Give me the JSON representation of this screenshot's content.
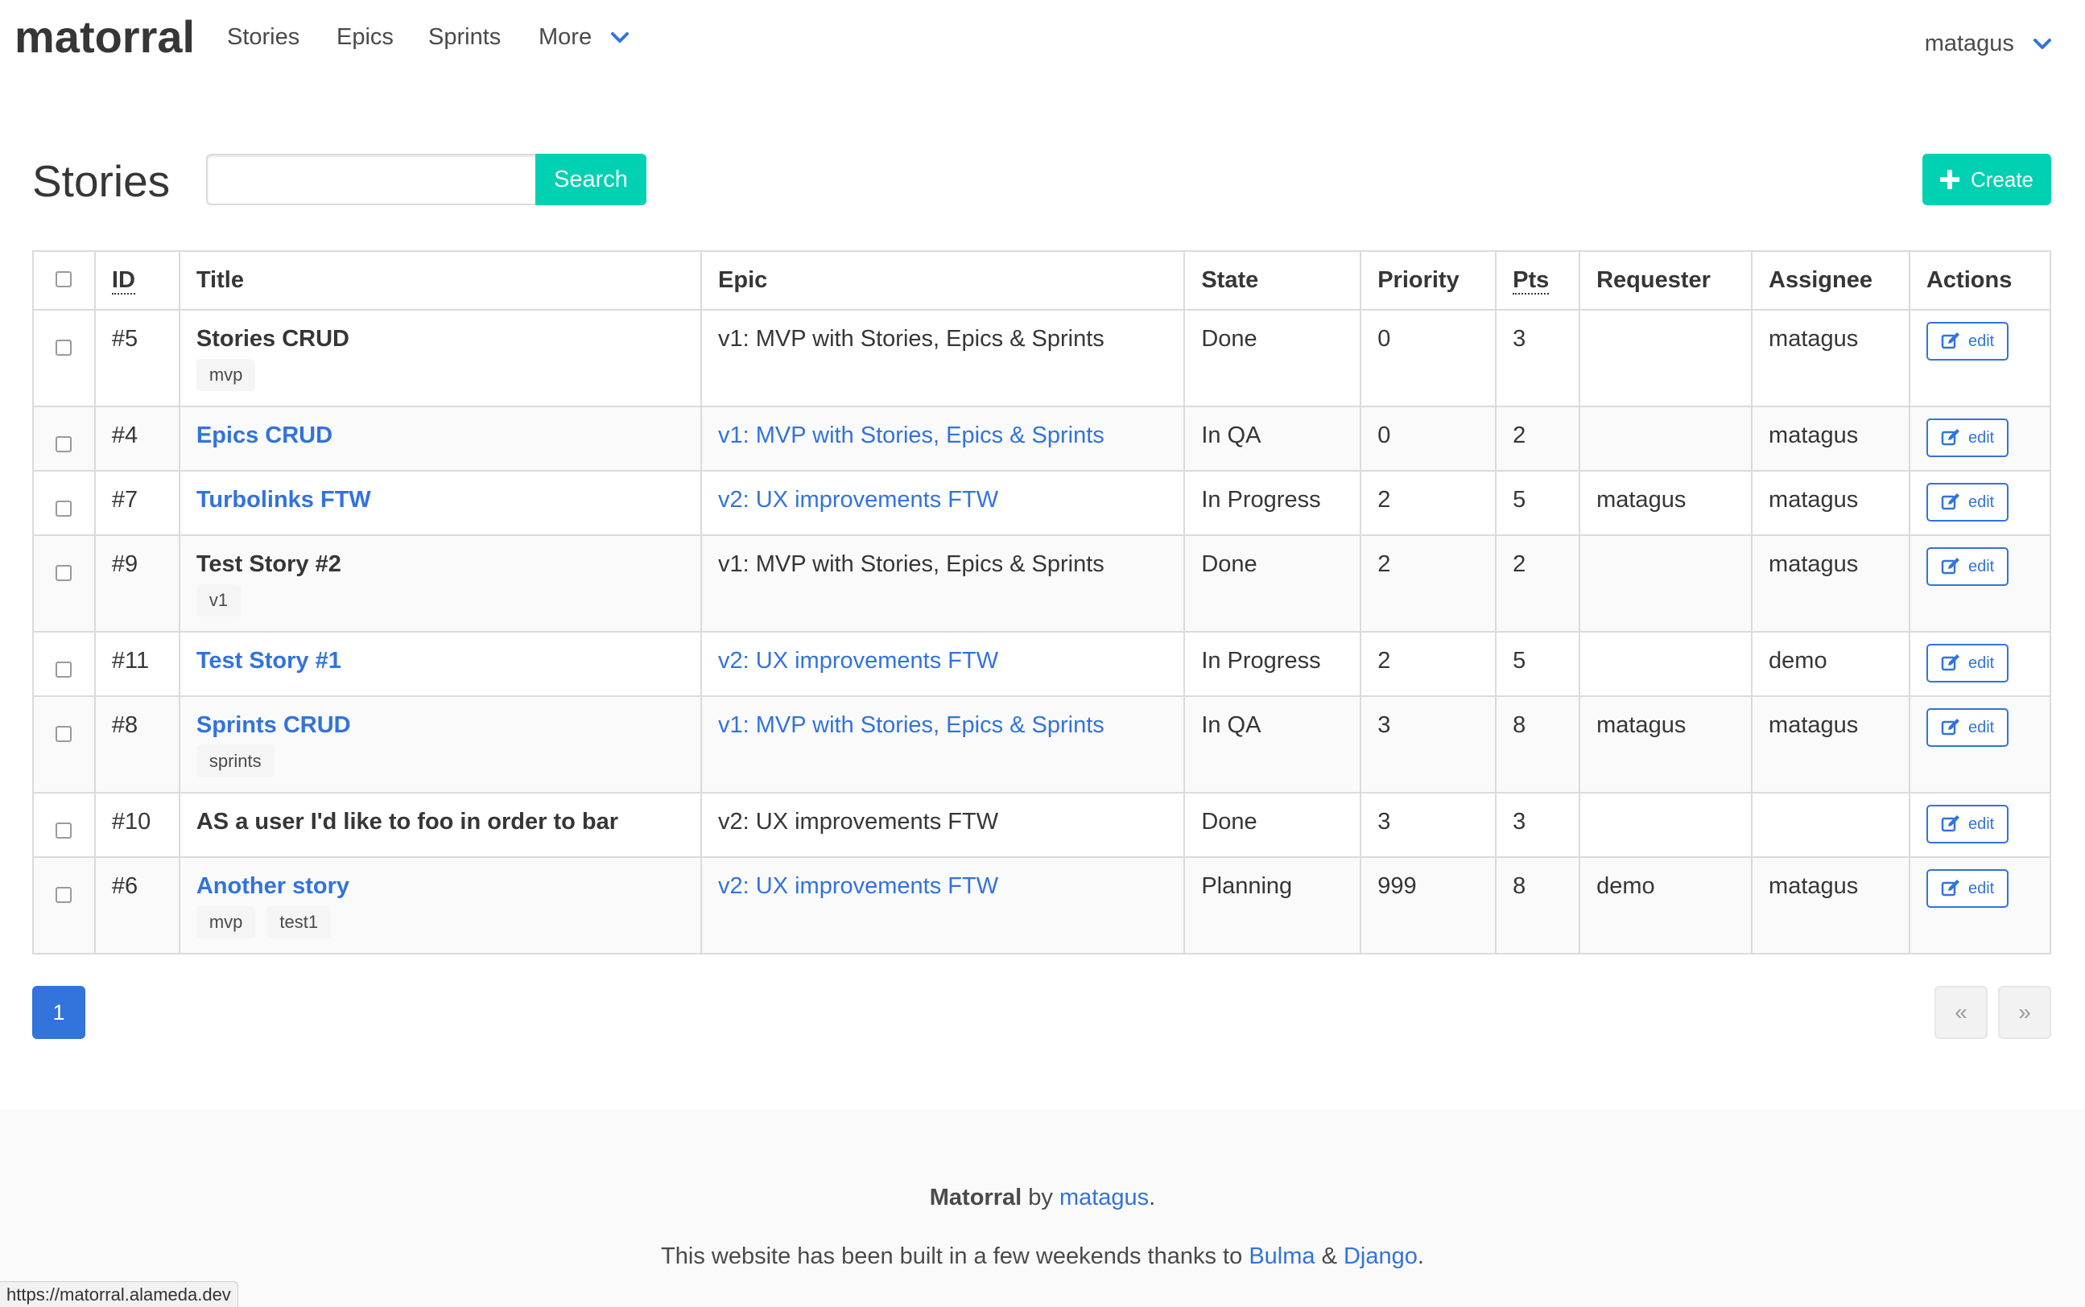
{
  "navbar": {
    "brand": "matorral",
    "items": [
      {
        "label": "Stories"
      },
      {
        "label": "Epics"
      },
      {
        "label": "Sprints"
      },
      {
        "label": "More"
      }
    ],
    "user": "matagus"
  },
  "header": {
    "title": "Stories",
    "search_placeholder": "",
    "search_label": "Search",
    "create_label": "Create"
  },
  "table": {
    "columns": [
      "ID",
      "Title",
      "Epic",
      "State",
      "Priority",
      "Pts",
      "Requester",
      "Assignee",
      "Actions"
    ],
    "rows": [
      {
        "id": "#5",
        "title": "Stories CRUD",
        "tags": [
          "mvp"
        ],
        "epic": "v1: MVP with Stories, Epics & Sprints",
        "state": "Done",
        "priority": "0",
        "pts": "3",
        "requester": "",
        "assignee": "matagus",
        "action": "edit"
      },
      {
        "id": "#4",
        "title": "Epics CRUD",
        "tags": [],
        "epic": "v1: MVP with Stories, Epics & Sprints",
        "state": "In QA",
        "priority": "0",
        "pts": "2",
        "requester": "",
        "assignee": "matagus",
        "action": "edit"
      },
      {
        "id": "#7",
        "title": "Turbolinks FTW",
        "tags": [],
        "epic": "v2: UX improvements FTW",
        "state": "In Progress",
        "priority": "2",
        "pts": "5",
        "requester": "matagus",
        "assignee": "matagus",
        "action": "edit"
      },
      {
        "id": "#9",
        "title": "Test Story #2",
        "tags": [
          "v1"
        ],
        "epic": "v1: MVP with Stories, Epics & Sprints",
        "state": "Done",
        "priority": "2",
        "pts": "2",
        "requester": "",
        "assignee": "matagus",
        "action": "edit"
      },
      {
        "id": "#11",
        "title": "Test Story #1",
        "tags": [],
        "epic": "v2: UX improvements FTW",
        "state": "In Progress",
        "priority": "2",
        "pts": "5",
        "requester": "",
        "assignee": "demo",
        "action": "edit"
      },
      {
        "id": "#8",
        "title": "Sprints CRUD",
        "tags": [
          "sprints"
        ],
        "epic": "v1: MVP with Stories, Epics & Sprints",
        "state": "In QA",
        "priority": "3",
        "pts": "8",
        "requester": "matagus",
        "assignee": "matagus",
        "action": "edit"
      },
      {
        "id": "#10",
        "title": "AS a user I'd like to foo in order to bar",
        "tags": [],
        "epic": "v2: UX improvements FTW",
        "state": "Done",
        "priority": "3",
        "pts": "3",
        "requester": "",
        "assignee": "",
        "action": "edit"
      },
      {
        "id": "#6",
        "title": "Another story",
        "tags": [
          "mvp",
          "test1"
        ],
        "epic": "v2: UX improvements FTW",
        "state": "Planning",
        "priority": "999",
        "pts": "8",
        "requester": "demo",
        "assignee": "matagus",
        "action": "edit"
      }
    ]
  },
  "pagination": {
    "current": "1",
    "prev": "«",
    "next": "»"
  },
  "footer": {
    "brand": "Matorral",
    "by": "by",
    "author": "matagus",
    "period": ".",
    "built_text": "This website has been built in a few weekends thanks to",
    "bulma": "Bulma",
    "amp": "&",
    "django": "Django"
  },
  "status_url": "https://matorral.alameda.dev",
  "colors": {
    "primary": "#00d1b2",
    "link": "#3273dc",
    "text": "#363636"
  }
}
